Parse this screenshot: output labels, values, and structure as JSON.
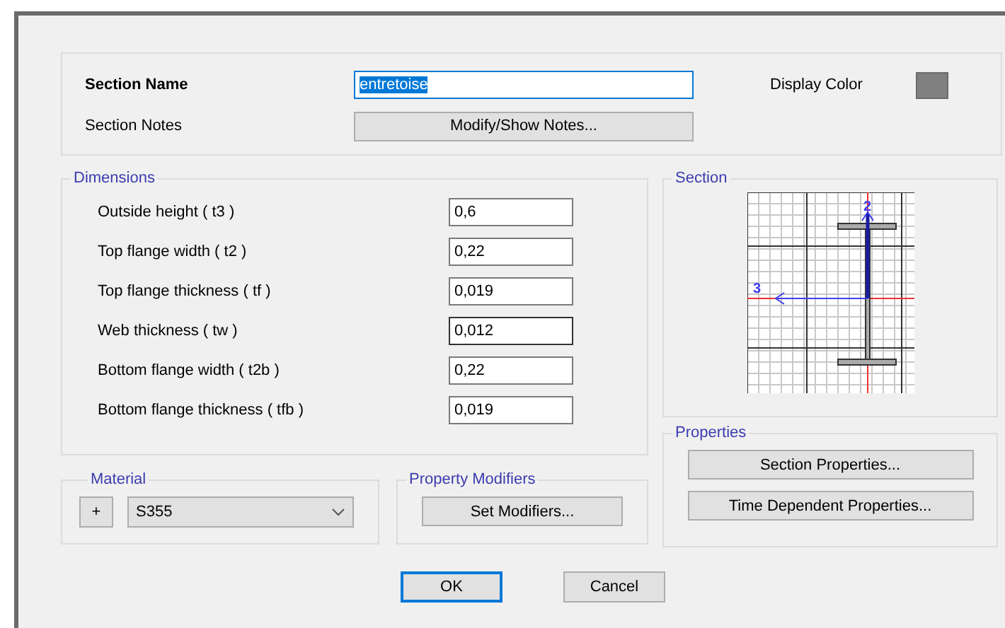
{
  "header": {
    "section_name_label": "Section Name",
    "section_name": "entretoise",
    "section_name_text_selected": true,
    "display_color_label": "Display Color",
    "section_notes_label": "Section Notes",
    "notes_button": "Modify/Show Notes..."
  },
  "dimensions": {
    "title": "Dimensions",
    "rows": [
      {
        "label": "Outside height  ( t3 )",
        "value": "0,6",
        "focused": false
      },
      {
        "label": "Top flange width  ( t2 )",
        "value": "0,22",
        "focused": false
      },
      {
        "label": "Top flange thickness  ( tf )",
        "value": "0,019",
        "focused": false
      },
      {
        "label": "Web thickness  ( tw )",
        "value": "0,012",
        "focused": true
      },
      {
        "label": "Bottom flange width  ( t2b )",
        "value": "0,22",
        "focused": false
      },
      {
        "label": "Bottom flange thickness  ( tfb )",
        "value": "0,019",
        "focused": false
      }
    ]
  },
  "section": {
    "title": "Section",
    "axis_vertical": "2",
    "axis_horizontal": "3"
  },
  "properties": {
    "title": "Properties",
    "buttons": [
      "Section Properties...",
      "Time Dependent Properties..."
    ]
  },
  "material": {
    "title": "Material",
    "add_button": "+",
    "value": "S355"
  },
  "property_modifiers": {
    "title": "Property Modifiers",
    "button": "Set Modifiers..."
  },
  "buttons": [
    {
      "label": "OK",
      "default": true
    },
    {
      "label": "Cancel",
      "default": false
    }
  ]
}
